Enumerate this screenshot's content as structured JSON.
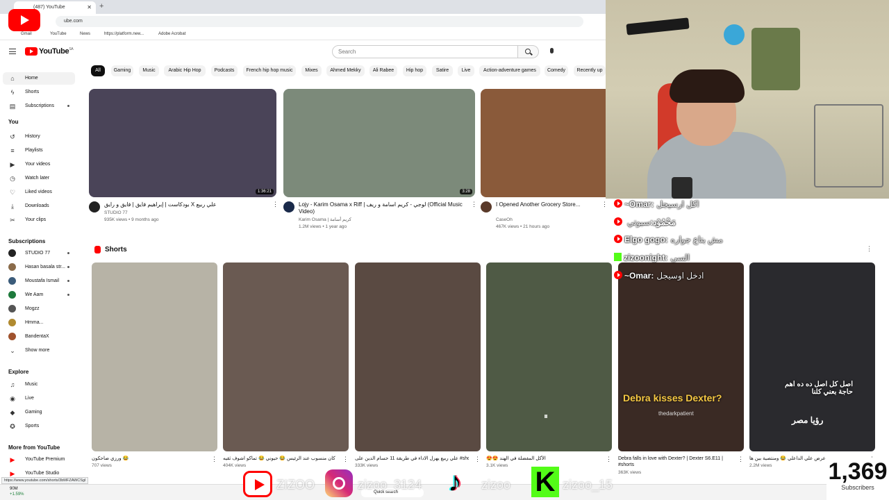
{
  "browser": {
    "tab_title": "(487) YouTube",
    "url": "ube.com",
    "bookmarks": [
      "Gmail",
      "YouTube",
      "News",
      "https://platform.new...",
      "Adobe Acrobat"
    ]
  },
  "header": {
    "logo": "YouTube",
    "region": "SA",
    "search_placeholder": "Search"
  },
  "sidebar": {
    "main": [
      {
        "label": "Home",
        "icon": "home-icon",
        "glyph": "⌂"
      },
      {
        "label": "Shorts",
        "icon": "shorts-icon",
        "glyph": "ϟ"
      },
      {
        "label": "Subscriptions",
        "icon": "subscriptions-icon",
        "glyph": "▤"
      }
    ],
    "you_heading": "You",
    "you": [
      {
        "label": "History",
        "glyph": "↺"
      },
      {
        "label": "Playlists",
        "glyph": "≡"
      },
      {
        "label": "Your videos",
        "glyph": "▶"
      },
      {
        "label": "Watch later",
        "glyph": "◷"
      },
      {
        "label": "Liked videos",
        "glyph": "♡"
      },
      {
        "label": "Downloads",
        "glyph": "⤓"
      },
      {
        "label": "Your clips",
        "glyph": "✂"
      }
    ],
    "subs_heading": "Subscriptions",
    "subs": [
      {
        "label": "STUDIO 77",
        "color": "#222222"
      },
      {
        "label": "Hasan basala str...",
        "color": "#8a6b4a"
      },
      {
        "label": "Moustafa Ismail",
        "color": "#3b5c7a"
      },
      {
        "label": "We Aam",
        "color": "#1e7a3c"
      },
      {
        "label": "Mogzz",
        "color": "#555555"
      },
      {
        "label": "Hmma...",
        "color": "#b08a30"
      },
      {
        "label": "BandentaX",
        "color": "#a0522d"
      }
    ],
    "show_more": "Show more",
    "explore_heading": "Explore",
    "explore": [
      {
        "label": "Music",
        "glyph": "♫"
      },
      {
        "label": "Live",
        "glyph": "◉"
      },
      {
        "label": "Gaming",
        "glyph": "◆"
      },
      {
        "label": "Sports",
        "glyph": "✪"
      }
    ],
    "more_heading": "More from YouTube",
    "more": [
      {
        "label": "YouTube Premium"
      },
      {
        "label": "YouTube Studio"
      }
    ],
    "status_url": "https://www.youtube.com/shorts/3bMFZAWCSgI"
  },
  "chips": [
    "All",
    "Gaming",
    "Music",
    "Arabic Hip Hop",
    "Podcasts",
    "French hip hop music",
    "Mixes",
    "Ahmed Mekky",
    "Ali Rabee",
    "Hip hop",
    "Satire",
    "Live",
    "Action-adventure games",
    "Comedy",
    "Recently up"
  ],
  "videos": [
    {
      "title": "بودكاست | إبراهيم فايق | فايق و رايق X علي ربيع",
      "channel": "STUDIO 77",
      "meta": "935K views • 9 months ago",
      "duration": "1:36:21",
      "color": "#4a4458",
      "avatar": "#222222"
    },
    {
      "title": "Lojy - Karim Osama x Riff | لوجي - كريم اسامة و ريف (Official Music Video)",
      "channel": "Karim Osama | كريم أسامة",
      "meta": "1.2M views • 1 year ago",
      "duration": "3:28",
      "color": "#7c8a7a",
      "avatar": "#1a2a4a"
    },
    {
      "title": "I Opened Another Grocery Store...",
      "channel": "CaseOh",
      "meta": "467K views • 21 hours ago",
      "duration": "",
      "color": "#8a5a3a",
      "avatar": "#5a3a2a"
    }
  ],
  "shorts_heading": "Shorts",
  "shorts": [
    {
      "title": "ورزي ضاحكون 😂",
      "views": "707 views",
      "color": "#b7b3a6"
    },
    {
      "title": "مدير عالم صلاح في الدشل حل المنازل كان منسوب عند الرئيس 😂 حيوني 😂 تماكو اشوف ثقيه",
      "views": "404K views",
      "color": "#6a5a52"
    },
    {
      "title": "علي ربيع يهزل الاداء في طريقة 11 حسام الدين على #shorts ... محمود و قاهرين #لحظة_11",
      "views": "333K views",
      "color": "#5a4a42"
    },
    {
      "title": "😍😍 الأكل المفضلة في الهند",
      "views": "3.1K views",
      "color": "#4f5a45"
    },
    {
      "title": "Debra falls in love with Dexter? | Dexter S6.E11 | #shorts",
      "views": "363K views",
      "color": "#3a2a24"
    },
    {
      "title": "يـ عرض علي الداعلي 😂 ومنتصية بين ها",
      "views": "2.2M views",
      "color": "#2a2a2e"
    }
  ],
  "short_captions": {
    "dexter": "Debra kisses Dexter?",
    "dexter_sub": "thedarkpatient",
    "roya": "اصل كل اصل ده ده اهم حاجة بعني كلنا",
    "roya_brand": "رؤيا مصر"
  },
  "chat": [
    {
      "user": "~Omar:",
      "msg": "اكل ارسيجل",
      "platform": "youtube"
    },
    {
      "user": "مَحْمُوْد:",
      "msg": "سبوتي",
      "platform": "youtube"
    },
    {
      "user": "Elgo gogo:",
      "msg": "مش بتاع جواره",
      "platform": "youtube"
    },
    {
      "user": "zizoonight:",
      "msg": "السي",
      "platform": "kick"
    },
    {
      "user": "~Omar:",
      "msg": "ادخل اوسيجل",
      "platform": "youtube"
    }
  ],
  "overlay": {
    "handles": [
      "ZIZOO",
      "zizoo_3124",
      "zizoo",
      "zizoo_15"
    ]
  },
  "subscribers": {
    "count": "1,369",
    "label": "Subscribers"
  },
  "taskbar": {
    "weather": "90M",
    "change": "+1.59%",
    "search": "Quick search"
  }
}
